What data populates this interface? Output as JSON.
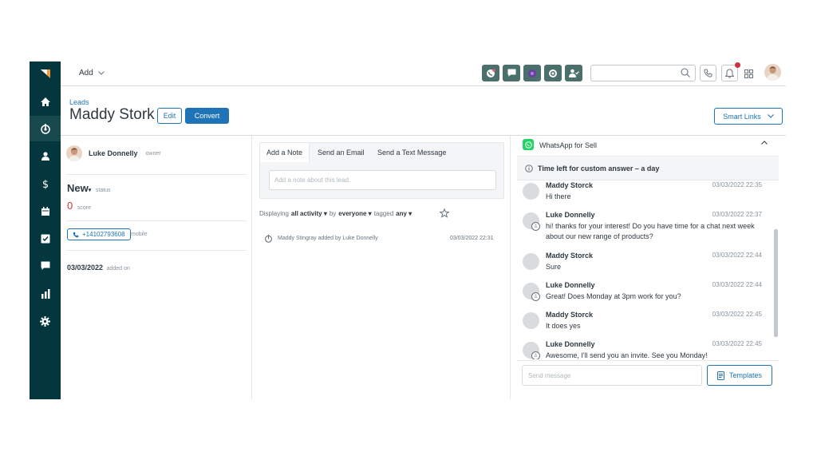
{
  "topbar": {
    "add_label": "Add"
  },
  "header": {
    "breadcrumb": "Leads",
    "title": "Maddy Stork",
    "edit_label": "Edit",
    "convert_label": "Convert",
    "smart_links_label": "Smart Links"
  },
  "lead": {
    "owner_name": "Luke Donnelly",
    "owner_label": "owner",
    "status": "New",
    "status_label": "status",
    "score": "0",
    "score_label": "score",
    "phone": "+14102793608",
    "phone_label": "mobile",
    "added_date": "03/03/2022",
    "added_label": "added on"
  },
  "activity": {
    "tabs": [
      "Add a Note",
      "Send an Email",
      "Send a Text Message"
    ],
    "note_placeholder": "Add a note about this lead.",
    "filter": {
      "displaying": "Displaying",
      "activity": "all activity",
      "by": "by",
      "who": "everyone",
      "tagged": "tagged",
      "tag": "any"
    },
    "entries": [
      {
        "text": "Maddy Stingray added by Luke Donnelly",
        "time": "03/03/2022 22:31"
      }
    ]
  },
  "whatsapp": {
    "title": "WhatsApp for Sell",
    "time_left": "Time left for custom answer – a day",
    "messages": [
      {
        "name": "Maddy Storck",
        "time": "03/03/2022 22:35",
        "text": "Hi there"
      },
      {
        "name": "Luke Donnelly",
        "time": "03/03/2022 22:37",
        "text": "hi! thanks for your interest! Do you have time for a chat next week about our new range of products?"
      },
      {
        "name": "Maddy Storck",
        "time": "03/03/2022 22:44",
        "text": "Sure"
      },
      {
        "name": "Luke Donnelly",
        "time": "03/03/2022 22:44",
        "text": "Great! Does Monday at 3pm work for you?"
      },
      {
        "name": "Maddy Storck",
        "time": "03/03/2022 22:45",
        "text": "It does yes"
      },
      {
        "name": "Luke Donnelly",
        "time": "03/03/2022 22:45",
        "text": "Awesome, I'll send you an invite. See you Monday!"
      }
    ],
    "send_placeholder": "Send message",
    "templates_label": "Templates"
  },
  "colors": {
    "sidebar": "#03363d",
    "primary": "#1f73b7",
    "whatsapp": "#25d366",
    "score": "#cc3340"
  },
  "icons": [
    "logo-icon",
    "home-icon",
    "leads-icon",
    "contacts-icon",
    "deals-icon",
    "calendar-icon",
    "tasks-icon",
    "chat-icon",
    "reports-icon",
    "settings-icon"
  ]
}
